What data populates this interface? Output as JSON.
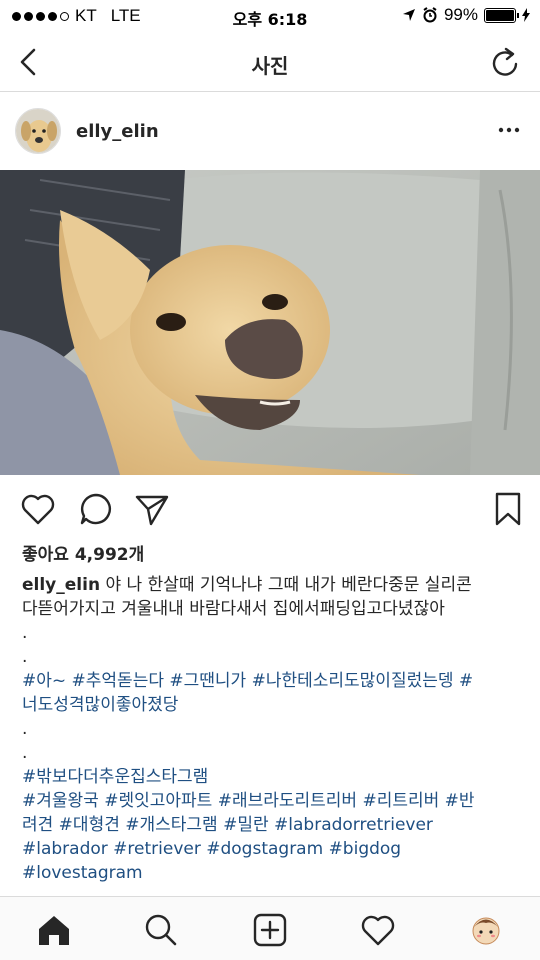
{
  "status_bar": {
    "carrier": "KT",
    "network": "LTE",
    "time": "오후 6:18",
    "battery": "99%",
    "battery_level": 0.99
  },
  "nav": {
    "title": "사진",
    "back_icon": "chevron-left-icon",
    "refresh_icon": "refresh-icon"
  },
  "post": {
    "username": "elly_elin",
    "likes": "좋아요 4,992개",
    "caption_lines": [
      {
        "user": "elly_elin",
        "text": " 야 나 한살때 기억나냐 그때 내가 베란다중문 실리콘"
      },
      {
        "text": "다뜯어가지고 겨울내내 바람다새서 집에서패딩입고다녔잖아"
      },
      {
        "dot": "."
      },
      {
        "dot": "."
      },
      {
        "tags": "#아~ #추억돋는다 #그땐니가 #나한테소리도많이질렀는뎅 #"
      },
      {
        "tags": "너도성격많이좋아졌당"
      },
      {
        "dot": "."
      },
      {
        "dot": "."
      },
      {
        "tags": "#밖보다더추운집스타그램"
      },
      {
        "tags": "#겨울왕국 #렛잇고아파트 #래브라도리트리버 #리트리버 #반"
      },
      {
        "tags": "려견 #대형견 #개스타그램 #밀란 #labradorretriever"
      },
      {
        "tags": "#labrador #retriever #dogstagram #bigdog"
      },
      {
        "tags": "#lovestagram"
      }
    ]
  },
  "colors": {
    "hashtag": "#1f4f82",
    "text": "#262626",
    "divider": "#dbdbdb"
  }
}
